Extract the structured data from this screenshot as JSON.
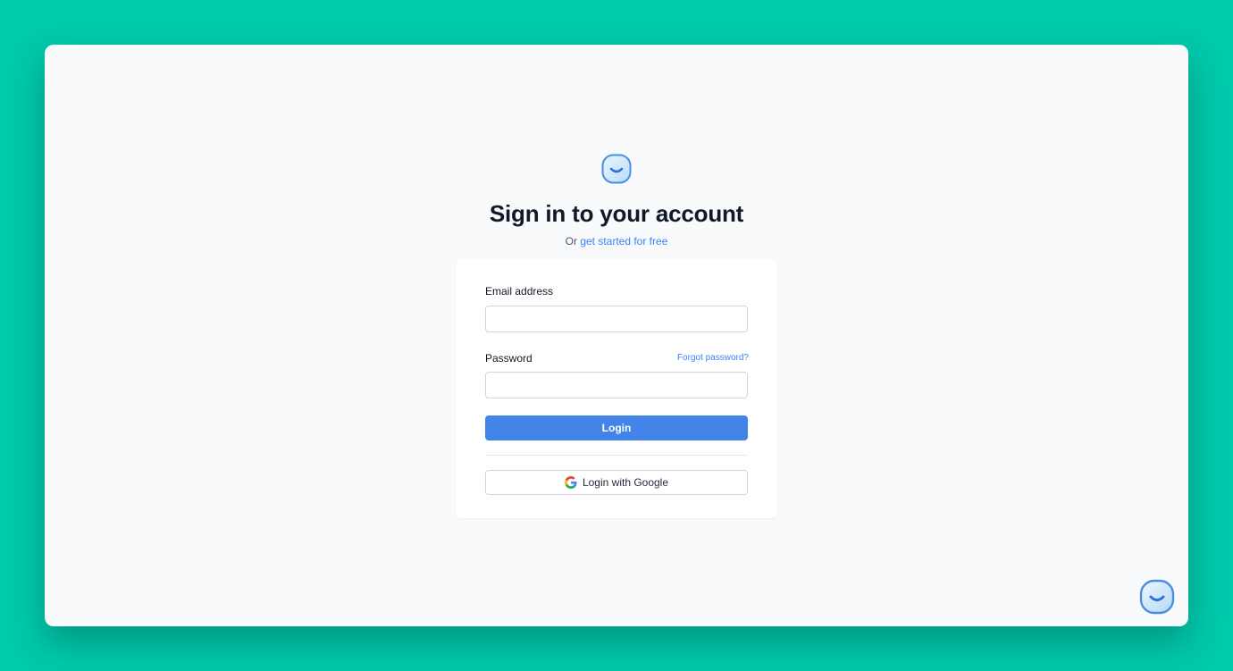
{
  "header": {
    "title": "Sign in to your account",
    "subtitle_prefix": "Or",
    "subtitle_link": "get started for free"
  },
  "form": {
    "email_label": "Email address",
    "email_value": "",
    "password_label": "Password",
    "password_value": "",
    "forgot_link": "Forgot password?",
    "login_button": "Login",
    "google_button": "Login with Google"
  },
  "icons": {
    "logo": "smile-logo-icon",
    "google": "google-icon",
    "chat_widget": "smile-chat-icon"
  },
  "colors": {
    "background": "#00c9ac",
    "primary": "#4384e8",
    "link": "#3b82f6"
  }
}
